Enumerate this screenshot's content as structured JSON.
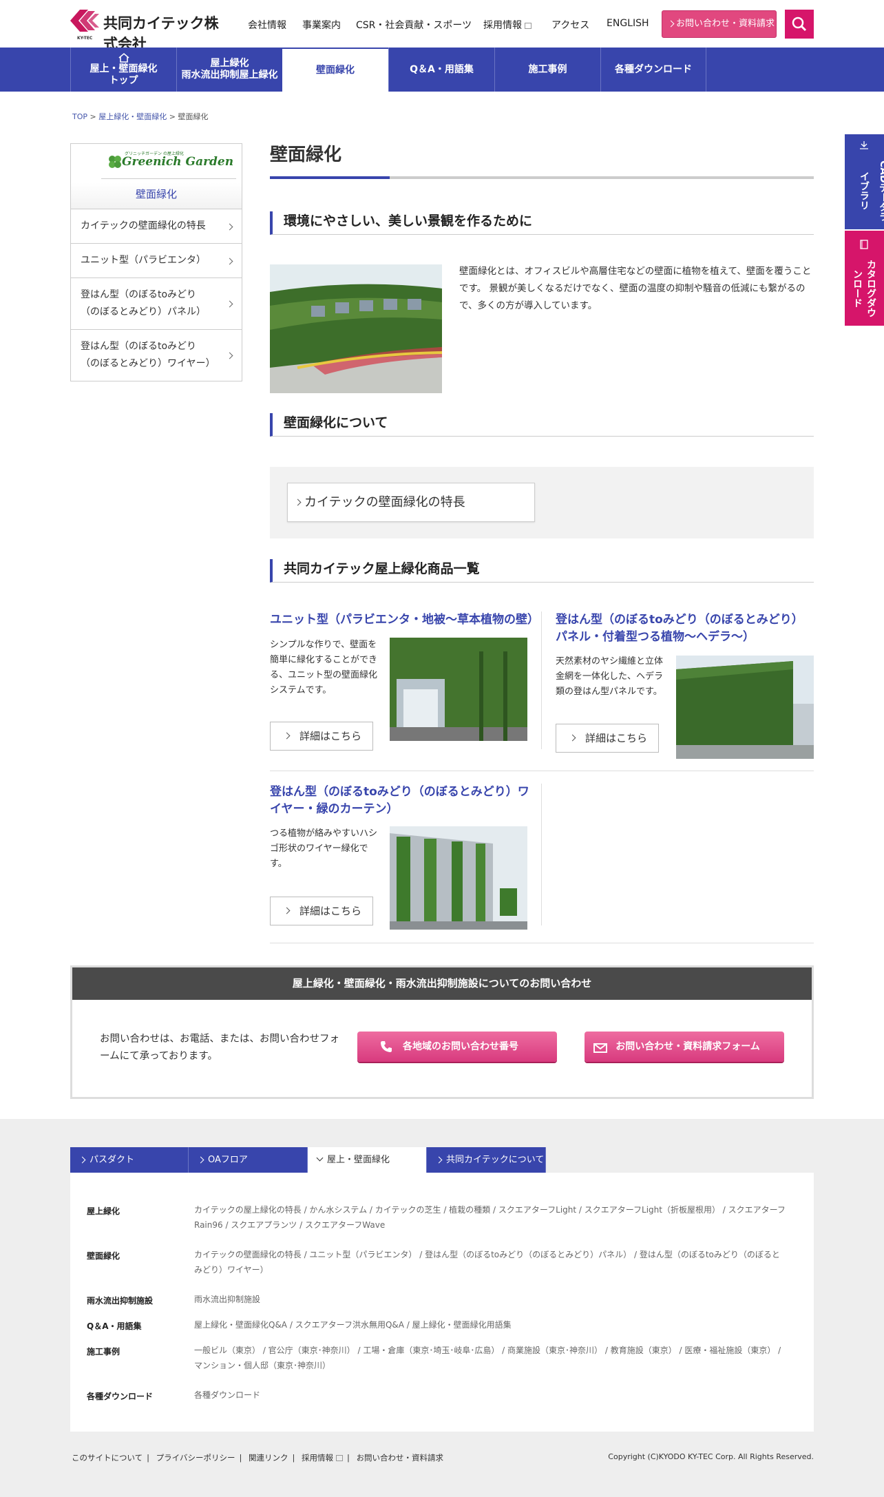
{
  "header": {
    "logo_text": "共同カイテック株式会社",
    "logo_sub": "KY-TEC",
    "nav": [
      {
        "label": "会社情報"
      },
      {
        "label": "事業案内"
      },
      {
        "label": "CSR・社会貢献・スポーツ"
      },
      {
        "label": "採用情報"
      },
      {
        "label": "アクセス"
      },
      {
        "label": "ENGLISH"
      }
    ],
    "contact_btn": "お問い合わせ・資料請求",
    "search_icon": "search-icon"
  },
  "menu": [
    {
      "line1": "屋上・壁面緑化",
      "line2": "トップ"
    },
    {
      "line1": "屋上緑化",
      "line2": "雨水流出抑制屋上緑化"
    },
    {
      "line1": "壁面緑化",
      "line2": ""
    },
    {
      "line1": "Q＆A・用語集",
      "line2": ""
    },
    {
      "line1": "施工事例",
      "line2": ""
    },
    {
      "line1": "各種ダウンロード",
      "line2": ""
    }
  ],
  "breadcrumb": {
    "top": "TOP",
    "sep": ">",
    "c1": "屋上緑化・壁面緑化",
    "c2": "壁面緑化"
  },
  "sidebar": {
    "logo_small": "グリニッチガーデン",
    "logo_small2": "の屋上緑化",
    "logo": "Greenich Garden",
    "title": "壁面緑化",
    "items": [
      {
        "label": "カイテックの壁面緑化の特長"
      },
      {
        "label": "ユニット型（パラビエンタ）"
      },
      {
        "label": "登はん型（のぼるtoみどり（のぼるとみどり）パネル）"
      },
      {
        "label": "登はん型（のぼるtoみどり（のぼるとみどり）ワイヤー）"
      }
    ]
  },
  "main": {
    "title": "壁面緑化",
    "h_intro": "環境にやさしい、美しい景観を作るために",
    "intro_text": "壁面緑化とは、オフィスビルや高層住宅などの壁面に植物を植えて、壁面を覆うことです。 景観が美しくなるだけでなく、壁面の温度の抑制や騒音の低減にも繋がるので、多くの方が導入しています。",
    "h_about": "壁面緑化について",
    "about_link": "カイテックの壁面緑化の特長",
    "h_products": "共同カイテック屋上緑化商品一覧",
    "products": [
      {
        "title": "ユニット型（パラビエンタ・地被～草本植物の壁）",
        "desc": "シンプルな作りで、壁面を簡単に緑化することができる、ユニット型の壁面緑化システムです。",
        "btn": "詳細はこちら"
      },
      {
        "title": "登はん型（のぼるtoみどり（のぼるとみどり）パネル・付着型つる植物～ヘデラ～）",
        "desc": "天然素材のヤシ繊維と立体金網を一体化した、ヘデラ類の登はん型パネルです。",
        "btn": "詳細はこちら"
      },
      {
        "title": "登はん型（のぼるtoみどり（のぼるとみどり）ワイヤー・緑のカーテン）",
        "desc": "つる植物が絡みやすいハシゴ形状のワイヤー緑化です。",
        "btn": "詳細はこちら"
      }
    ]
  },
  "contact": {
    "heading": "屋上緑化・壁面緑化・雨水流出抑制施設についてのお問い合わせ",
    "text": "お問い合わせは、お電話、または、お問い合わせフォームにて承っております。",
    "phone_btn": "各地域のお問い合わせ番号",
    "form_btn": "お問い合わせ・資料請求フォーム"
  },
  "footer": {
    "tabs": [
      {
        "label": "パスダクト"
      },
      {
        "label": "OAフロア"
      },
      {
        "label": "屋上・壁面緑化"
      },
      {
        "label": "共同カイテックについて"
      }
    ],
    "rows": [
      {
        "label": "屋上緑化",
        "links": "カイテックの屋上緑化の特長 / かん水システム / カイテックの芝生 / 植栽の種類 / スクエアターフLight / スクエアターフLight（折板屋根用） / スクエアターフRain96 / スクエアプランツ / スクエアターフWave"
      },
      {
        "label": "壁面緑化",
        "links": "カイテックの壁面緑化の特長 / ユニット型（パラビエンタ） / 登はん型（のぼるtoみどり（のぼるとみどり）パネル） / 登はん型（のぼるtoみどり（のぼるとみどり）ワイヤー）"
      },
      {
        "label": "雨水流出抑制施設",
        "links": "雨水流出抑制施設"
      },
      {
        "label": "Q＆A・用語集",
        "links": "屋上緑化・壁面緑化Q&A / スクエアターフ洪水無用Q&A / 屋上緑化・壁面緑化用語集"
      },
      {
        "label": "施工事例",
        "links": "一般ビル（東京） / 官公庁（東京･神奈川） / 工場・倉庫（東京･埼玉･岐阜･広島） / 商業施設（東京･神奈川） / 教育施設（東京） / 医療・福祉施設（東京） / マンション・個人邸（東京･神奈川）"
      },
      {
        "label": "各種ダウンロード",
        "links": "各種ダウンロード"
      }
    ],
    "bottom_links": [
      "このサイトについて",
      "プライバシーポリシー",
      "関連リンク",
      "採用情報",
      "お問い合わせ・資料請求"
    ],
    "copyright": "Copyright (C)KYODO KY-TEC Corp. All Rights Reserved."
  },
  "side_tabs": [
    {
      "label": "CADデータライブラリ",
      "color": "#3845ac"
    },
    {
      "label": "カタログダウンロード",
      "color": "#d6156a"
    }
  ]
}
